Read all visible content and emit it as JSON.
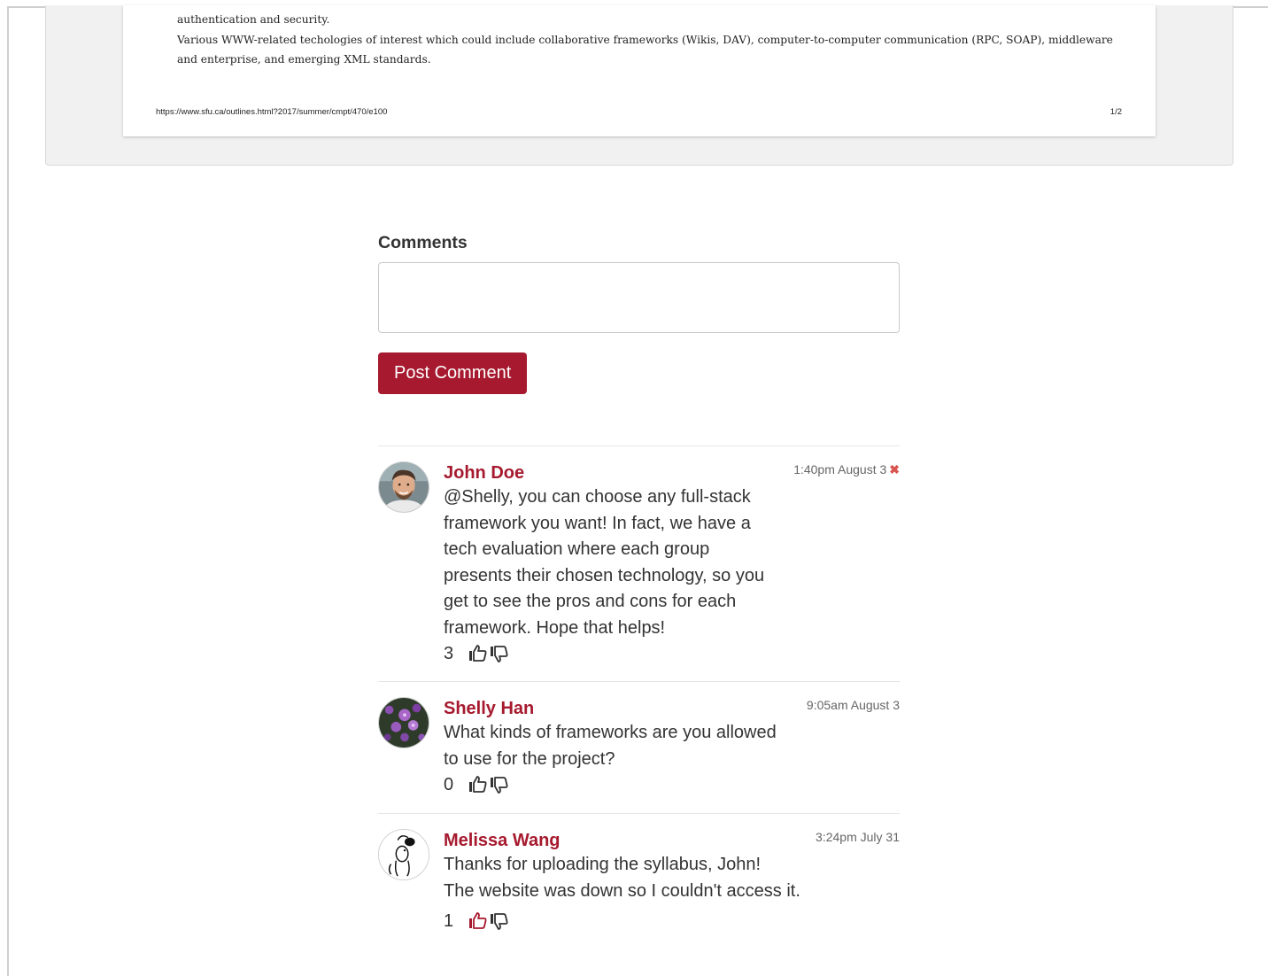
{
  "document": {
    "lines": [
      "authentication and security.",
      "Various WWW-related techologies of interest which could include collaborative frameworks (Wikis, DAV), computer-to-computer communication (RPC, SOAP), middleware",
      "and enterprise, and emerging XML standards."
    ],
    "footer_url": "https://www.sfu.ca/outlines.html?2017/summer/cmpt/470/e100",
    "page_indicator": "1/2"
  },
  "comments_section": {
    "heading": "Comments",
    "input_value": "",
    "post_button_label": "Post Comment"
  },
  "colors": {
    "accent": "#a6192e",
    "delete": "#d9534f"
  },
  "comments": [
    {
      "author": "John Doe",
      "timestamp": "1:40pm August 3",
      "text": "@Shelly, you can choose any full-stack framework you want! In fact, we have a tech evaluation where each group presents their chosen technology, so you get to see the pros and cons for each framework. Hope that helps!",
      "votes": "3",
      "deletable": true,
      "liked": false,
      "avatar_icon": "man-portrait-avatar"
    },
    {
      "author": "Shelly Han",
      "timestamp": "9:05am August 3",
      "text": "What kinds of frameworks are you allowed to use for the project?",
      "votes": "0",
      "deletable": false,
      "liked": false,
      "avatar_icon": "purple-flowers-avatar"
    },
    {
      "author": "Melissa Wang",
      "timestamp": "3:24pm July 31",
      "text_lines": [
        "Thanks for uploading the syllabus, John!",
        "The website was down so I couldn't access it."
      ],
      "votes": "1",
      "deletable": false,
      "liked": true,
      "avatar_icon": "cartoon-dog-avatar"
    }
  ]
}
